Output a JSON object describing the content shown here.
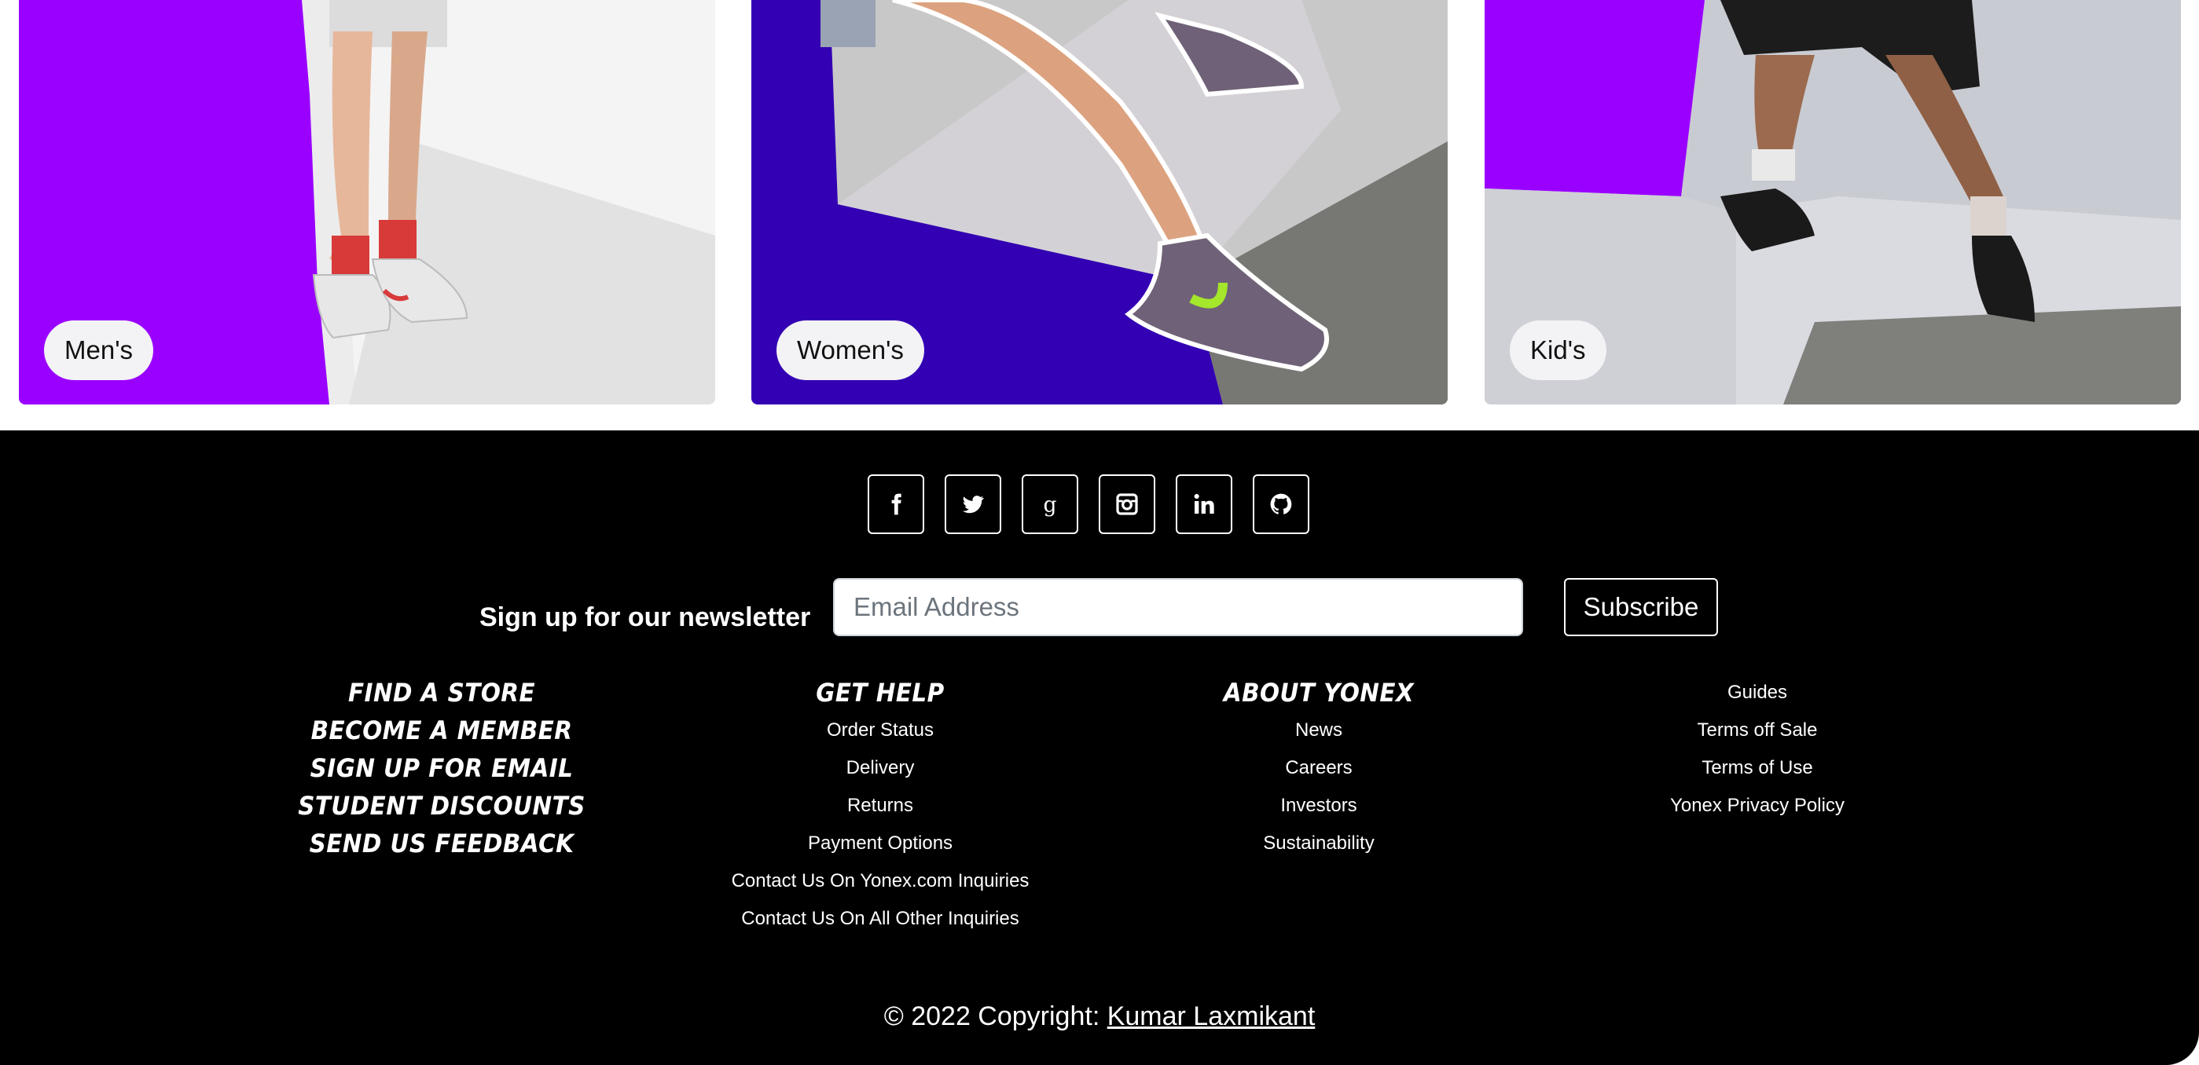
{
  "categories": [
    {
      "label": "Men's"
    },
    {
      "label": "Women's"
    },
    {
      "label": "Kid's"
    }
  ],
  "colors": {
    "accent_purple": "#9a00ff",
    "accent_indigo": "#3300b3",
    "footer_bg": "#000000"
  },
  "footer": {
    "socials": [
      {
        "icon": "facebook-icon"
      },
      {
        "icon": "twitter-icon"
      },
      {
        "icon": "google-icon"
      },
      {
        "icon": "instagram-icon"
      },
      {
        "icon": "linkedin-icon"
      },
      {
        "icon": "github-icon"
      }
    ],
    "newsletter": {
      "label": "Sign up for our newsletter",
      "placeholder": "Email Address",
      "button": "Subscribe"
    },
    "col_find": [
      "FIND A STORE",
      "BECOME A MEMBER",
      "SIGN UP FOR EMAIL",
      "STUDENT DISCOUNTS",
      "SEND US FEEDBACK"
    ],
    "col_help": {
      "heading": "GET HELP",
      "links": [
        "Order Status",
        "Delivery",
        "Returns",
        "Payment Options",
        "Contact Us On Yonex.com Inquiries",
        "Contact Us On All Other Inquiries"
      ]
    },
    "col_about": {
      "heading": "ABOUT YONEX",
      "links": [
        "News",
        "Careers",
        "Investors",
        "Sustainability"
      ]
    },
    "col_guides": {
      "links": [
        "Guides",
        "Terms off Sale",
        "Terms of Use",
        "Yonex Privacy Policy"
      ]
    },
    "copyright": {
      "text": "© 2022 Copyright: ",
      "author": "Kumar Laxmikant"
    }
  }
}
